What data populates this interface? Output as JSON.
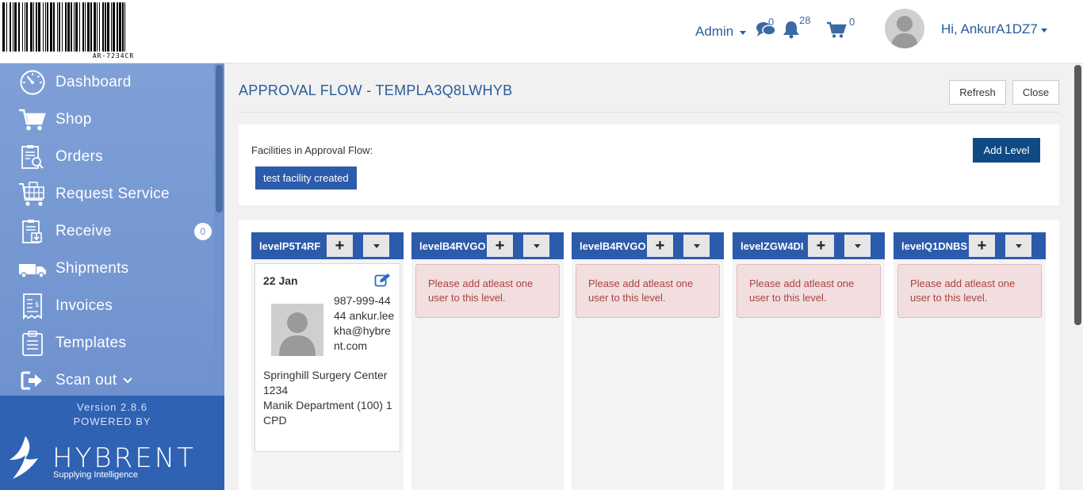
{
  "header": {
    "barcode_text": "AR-7234CR",
    "admin_label": "Admin",
    "messages_count": "0",
    "notifications_count": "28",
    "cart_count": "0",
    "user_greeting": "Hi, AnkurA1DZ7"
  },
  "sidebar": {
    "items": [
      {
        "label": "Dashboard",
        "icon": "dashboard-icon"
      },
      {
        "label": "Shop",
        "icon": "cart-icon"
      },
      {
        "label": "Orders",
        "icon": "orders-icon"
      },
      {
        "label": "Request Service",
        "icon": "request-service-icon"
      },
      {
        "label": "Receive",
        "icon": "receive-icon",
        "badge": "0"
      },
      {
        "label": "Shipments",
        "icon": "truck-icon"
      },
      {
        "label": "Invoices",
        "icon": "invoice-icon"
      },
      {
        "label": "Templates",
        "icon": "templates-icon"
      },
      {
        "label": "Scan out",
        "icon": "scan-out-icon"
      }
    ],
    "version": "Version 2.8.6",
    "powered_by": "POWERED BY",
    "logo_word": "HYBRENT",
    "logo_tagline": "Supplying Intelligence"
  },
  "main": {
    "title": "APPROVAL FLOW - TEMPLA3Q8LWHYB",
    "refresh_label": "Refresh",
    "close_label": "Close",
    "facilities_label": "Facilities in Approval Flow:",
    "facility_tag": "test facility created",
    "add_level_label": "Add Level",
    "levels": [
      {
        "name": "levelP5T4RF"
      },
      {
        "name": "levelB4RVGO",
        "warning": "Please add atleast one user to this level."
      },
      {
        "name": "levelB4RVGO",
        "warning": "Please add atleast one user to this level."
      },
      {
        "name": "levelZGW4DI",
        "warning": "Please add atleast one user to this level."
      },
      {
        "name": "levelQ1DNBS",
        "warning": "Please add atleast one user to this level."
      }
    ],
    "user_card": {
      "date": "22 Jan",
      "contact": "987-999-4444 ankur.leekha@hybrent.com",
      "facility": "Springhill Surgery Center 1234",
      "department": "Manik Department (100) 1",
      "code": "CPD"
    }
  },
  "colors": {
    "primary": "#2c5bab",
    "accent_dark": "#0f4a85",
    "sidebar_nav": "#7fa0d6",
    "warning_bg": "#f2dede",
    "warning_text": "#a94442"
  }
}
